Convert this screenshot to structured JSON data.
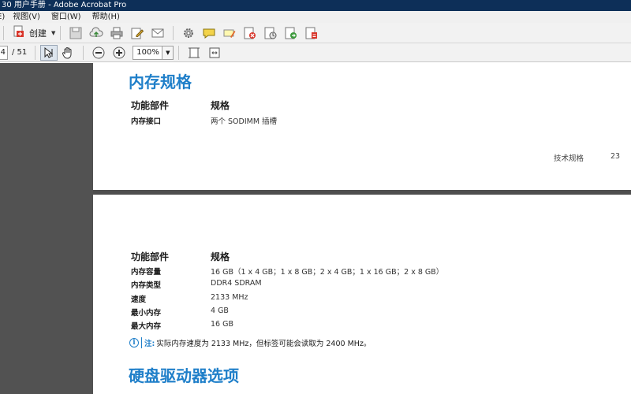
{
  "window": {
    "title": "30 用户手册 - Adobe Acrobat Pro"
  },
  "menu": [
    "E)",
    "视图(V)",
    "窗口(W)",
    "帮助(H)"
  ],
  "toolbar": {
    "create_label": "创建"
  },
  "navigation": {
    "page_number": "4",
    "page_total": "/ 51",
    "zoom": "100%"
  },
  "icons": {
    "create": "create-pdf-icon",
    "save": "save-icon",
    "upload": "cloud-upload-icon",
    "print": "print-icon",
    "edit": "edit-icon",
    "email": "email-icon",
    "settings": "settings-icon",
    "comment": "comment-icon",
    "highlight": "highlight-icon",
    "sign": "sign-icon",
    "stamp": "stamp-icon",
    "export": "export-icon",
    "form": "form-icon",
    "select": "select-tool-icon",
    "hand": "hand-tool-icon",
    "zoom_out": "zoom-out-icon",
    "zoom_in": "zoom-in-icon",
    "fit_page": "fit-page-icon",
    "fit_width": "fit-width-icon"
  },
  "page1": {
    "heading": "内存规格",
    "col_component": "功能部件",
    "col_spec": "规格",
    "rows": [
      {
        "label": "内存接口",
        "value": "两个 SODIMM 插槽"
      }
    ],
    "footer_section": "技术规格",
    "footer_page": "23"
  },
  "page2": {
    "col_component": "功能部件",
    "col_spec": "规格",
    "rows": [
      {
        "label": "内存容量",
        "value": "16 GB（1 x 4 GB；1 x 8 GB；2 x 4 GB；1 x 16 GB；2 x 8 GB）"
      },
      {
        "label": "内存类型",
        "value": "DDR4 SDRAM"
      },
      {
        "label": "速度",
        "value": "2133 MHz"
      },
      {
        "label": "最小内存",
        "value": "4 GB"
      },
      {
        "label": "最大内存",
        "value": "16 GB"
      }
    ],
    "note_label": "注:",
    "note_text": "实际内存速度为 2133 MHz，但标签可能会读取为 2400 MHz。",
    "heading": "硬盘驱动器选项"
  },
  "colors": {
    "accent": "#1f7fc9",
    "titlebar": "#0d2f58",
    "gutter": "#525252"
  }
}
